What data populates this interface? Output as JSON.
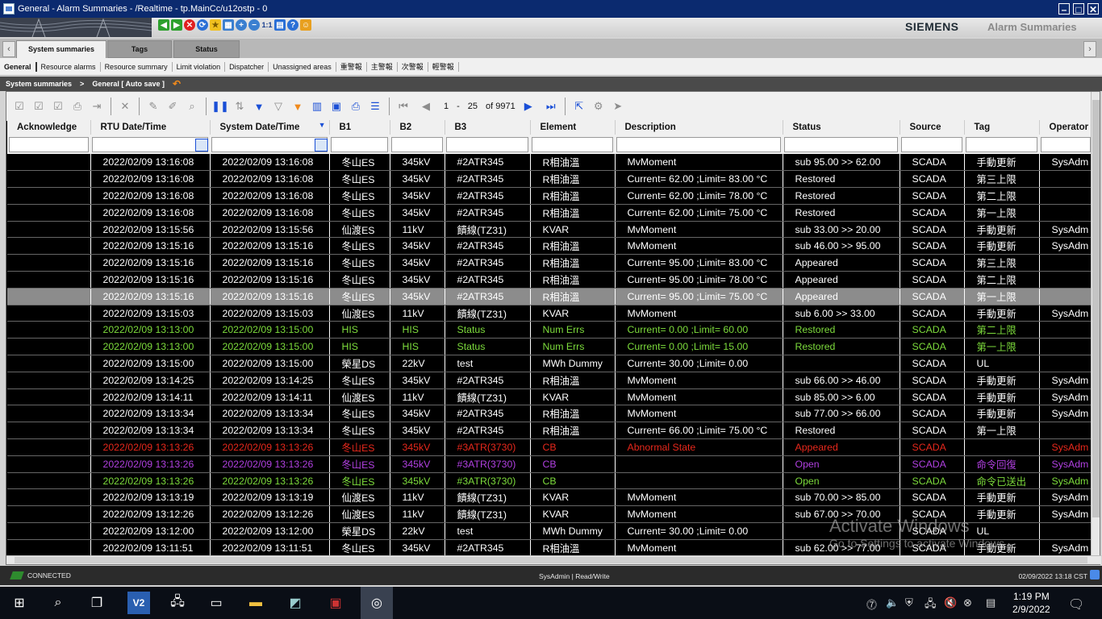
{
  "window": {
    "title": "General - Alarm Summaries - /Realtime - tp.MainCc/u12ostp - 0"
  },
  "banner": {
    "brand": "SIEMENS",
    "app_title": "Alarm Summaries",
    "zoom_label": "1:1"
  },
  "tabs": [
    {
      "label": "System summaries",
      "active": true
    },
    {
      "label": "Tags",
      "active": false
    },
    {
      "label": "Status",
      "active": false
    }
  ],
  "subtabs": [
    "General",
    "Resource alarms",
    "Resource summary",
    "Limit violation",
    "Dispatcher",
    "Unassigned areas",
    "重警報",
    "主警報",
    "次警報",
    "輕警報"
  ],
  "breadcrumb": {
    "root": "System summaries",
    "separator": ">",
    "current": "General  [ Auto save ]"
  },
  "pager": {
    "current": "1",
    "dash": "-",
    "size": "25",
    "of_label": "of 9971"
  },
  "columns": [
    "Acknowledge",
    "RTU Date/Time",
    "System Date/Time",
    "B1",
    "B2",
    "B3",
    "Element",
    "Description",
    "Status",
    "Source",
    "Tag",
    "Operator"
  ],
  "colors": {
    "white": "#ffffff",
    "green": "#7ddc3c",
    "red": "#e8281c",
    "purple": "#b040e0",
    "selected_bg": "#8c8c8c",
    "row_bg": "#000000"
  },
  "rows": [
    {
      "ack": "",
      "rtu": "2022/02/09 13:16:08",
      "sys": "2022/02/09 13:16:08",
      "b1": "冬山ES",
      "b2": "345kV",
      "b3": "#2ATR345",
      "element": "R相油溫",
      "description": "MvMoment",
      "status": "sub 95.00  >> 62.00",
      "source": "SCADA",
      "tag": "手動更新",
      "operator": "SysAdm",
      "color": "white"
    },
    {
      "ack": "",
      "rtu": "2022/02/09 13:16:08",
      "sys": "2022/02/09 13:16:08",
      "b1": "冬山ES",
      "b2": "345kV",
      "b3": "#2ATR345",
      "element": "R相油溫",
      "description": "Current= 62.00 ;Limit= 83.00 °C",
      "status": "Restored",
      "source": "SCADA",
      "tag": "第三上限",
      "operator": "",
      "color": "white"
    },
    {
      "ack": "",
      "rtu": "2022/02/09 13:16:08",
      "sys": "2022/02/09 13:16:08",
      "b1": "冬山ES",
      "b2": "345kV",
      "b3": "#2ATR345",
      "element": "R相油溫",
      "description": "Current= 62.00 ;Limit= 78.00 °C",
      "status": "Restored",
      "source": "SCADA",
      "tag": "第二上限",
      "operator": "",
      "color": "white"
    },
    {
      "ack": "",
      "rtu": "2022/02/09 13:16:08",
      "sys": "2022/02/09 13:16:08",
      "b1": "冬山ES",
      "b2": "345kV",
      "b3": "#2ATR345",
      "element": "R相油溫",
      "description": "Current= 62.00 ;Limit= 75.00 °C",
      "status": "Restored",
      "source": "SCADA",
      "tag": "第一上限",
      "operator": "",
      "color": "white"
    },
    {
      "ack": "",
      "rtu": "2022/02/09 13:15:56",
      "sys": "2022/02/09 13:15:56",
      "b1": "仙渡ES",
      "b2": "11kV",
      "b3": "饋線(TZ31)",
      "element": "KVAR",
      "description": "MvMoment",
      "status": "sub 33.00  >> 20.00",
      "source": "SCADA",
      "tag": "手動更新",
      "operator": "SysAdm",
      "color": "white"
    },
    {
      "ack": "",
      "rtu": "2022/02/09 13:15:16",
      "sys": "2022/02/09 13:15:16",
      "b1": "冬山ES",
      "b2": "345kV",
      "b3": "#2ATR345",
      "element": "R相油溫",
      "description": "MvMoment",
      "status": "sub 46.00  >> 95.00",
      "source": "SCADA",
      "tag": "手動更新",
      "operator": "SysAdm",
      "color": "white"
    },
    {
      "ack": "",
      "rtu": "2022/02/09 13:15:16",
      "sys": "2022/02/09 13:15:16",
      "b1": "冬山ES",
      "b2": "345kV",
      "b3": "#2ATR345",
      "element": "R相油溫",
      "description": "Current= 95.00 ;Limit= 83.00 °C",
      "status": "Appeared",
      "source": "SCADA",
      "tag": "第三上限",
      "operator": "",
      "color": "white"
    },
    {
      "ack": "",
      "rtu": "2022/02/09 13:15:16",
      "sys": "2022/02/09 13:15:16",
      "b1": "冬山ES",
      "b2": "345kV",
      "b3": "#2ATR345",
      "element": "R相油溫",
      "description": "Current= 95.00 ;Limit= 78.00 °C",
      "status": "Appeared",
      "source": "SCADA",
      "tag": "第二上限",
      "operator": "",
      "color": "white"
    },
    {
      "ack": "",
      "rtu": "2022/02/09 13:15:16",
      "sys": "2022/02/09 13:15:16",
      "b1": "冬山ES",
      "b2": "345kV",
      "b3": "#2ATR345",
      "element": "R相油溫",
      "description": "Current= 95.00 ;Limit= 75.00 °C",
      "status": "Appeared",
      "source": "SCADA",
      "tag": "第一上限",
      "operator": "",
      "color": "white",
      "selected": true
    },
    {
      "ack": "",
      "rtu": "2022/02/09 13:15:03",
      "sys": "2022/02/09 13:15:03",
      "b1": "仙渡ES",
      "b2": "11kV",
      "b3": "饋線(TZ31)",
      "element": "KVAR",
      "description": "MvMoment",
      "status": "sub 6.00  >> 33.00",
      "source": "SCADA",
      "tag": "手動更新",
      "operator": "SysAdm",
      "color": "white"
    },
    {
      "ack": "",
      "rtu": "2022/02/09 13:13:00",
      "sys": "2022/02/09 13:15:00",
      "b1": "HIS",
      "b2": "HIS",
      "b3": "Status",
      "element": "Num Errs",
      "description": "Current= 0.00 ;Limit= 60.00",
      "status": "Restored",
      "source": "SCADA",
      "tag": "第二上限",
      "operator": "",
      "color": "green"
    },
    {
      "ack": "",
      "rtu": "2022/02/09 13:13:00",
      "sys": "2022/02/09 13:15:00",
      "b1": "HIS",
      "b2": "HIS",
      "b3": "Status",
      "element": "Num Errs",
      "description": "Current= 0.00 ;Limit= 15.00",
      "status": "Restored",
      "source": "SCADA",
      "tag": "第一上限",
      "operator": "",
      "color": "green"
    },
    {
      "ack": "",
      "rtu": "2022/02/09 13:15:00",
      "sys": "2022/02/09 13:15:00",
      "b1": "榮星DS",
      "b2": "22kV",
      "b3": "test",
      "element": "MWh Dummy",
      "description": "Current= 30.00 ;Limit= 0.00",
      "status": "",
      "source": "SCADA",
      "tag": "UL",
      "operator": "",
      "color": "white"
    },
    {
      "ack": "",
      "rtu": "2022/02/09 13:14:25",
      "sys": "2022/02/09 13:14:25",
      "b1": "冬山ES",
      "b2": "345kV",
      "b3": "#2ATR345",
      "element": "R相油溫",
      "description": "MvMoment",
      "status": "sub 66.00  >> 46.00",
      "source": "SCADA",
      "tag": "手動更新",
      "operator": "SysAdm",
      "color": "white"
    },
    {
      "ack": "",
      "rtu": "2022/02/09 13:14:11",
      "sys": "2022/02/09 13:14:11",
      "b1": "仙渡ES",
      "b2": "11kV",
      "b3": "饋線(TZ31)",
      "element": "KVAR",
      "description": "MvMoment",
      "status": "sub 85.00  >> 6.00",
      "source": "SCADA",
      "tag": "手動更新",
      "operator": "SysAdm",
      "color": "white"
    },
    {
      "ack": "",
      "rtu": "2022/02/09 13:13:34",
      "sys": "2022/02/09 13:13:34",
      "b1": "冬山ES",
      "b2": "345kV",
      "b3": "#2ATR345",
      "element": "R相油溫",
      "description": "MvMoment",
      "status": "sub 77.00  >> 66.00",
      "source": "SCADA",
      "tag": "手動更新",
      "operator": "SysAdm",
      "color": "white"
    },
    {
      "ack": "",
      "rtu": "2022/02/09 13:13:34",
      "sys": "2022/02/09 13:13:34",
      "b1": "冬山ES",
      "b2": "345kV",
      "b3": "#2ATR345",
      "element": "R相油溫",
      "description": "Current= 66.00 ;Limit= 75.00 °C",
      "status": "Restored",
      "source": "SCADA",
      "tag": "第一上限",
      "operator": "",
      "color": "white"
    },
    {
      "ack": "",
      "rtu": "2022/02/09 13:13:26",
      "sys": "2022/02/09 13:13:26",
      "b1": "冬山ES",
      "b2": "345kV",
      "b3": "#3ATR(3730)",
      "element": "CB",
      "description": "Abnormal State",
      "status": "Appeared",
      "source": "SCADA",
      "tag": "",
      "operator": "SysAdm",
      "color": "red"
    },
    {
      "ack": "",
      "rtu": "2022/02/09 13:13:26",
      "sys": "2022/02/09 13:13:26",
      "b1": "冬山ES",
      "b2": "345kV",
      "b3": "#3ATR(3730)",
      "element": "CB",
      "description": "",
      "status": "Open",
      "source": "SCADA",
      "tag": "命令回復",
      "operator": "SysAdm",
      "color": "purple"
    },
    {
      "ack": "",
      "rtu": "2022/02/09 13:13:26",
      "sys": "2022/02/09 13:13:26",
      "b1": "冬山ES",
      "b2": "345kV",
      "b3": "#3ATR(3730)",
      "element": "CB",
      "description": "",
      "status": "Open",
      "source": "SCADA",
      "tag": "命令已送出",
      "operator": "SysAdm",
      "color": "green"
    },
    {
      "ack": "",
      "rtu": "2022/02/09 13:13:19",
      "sys": "2022/02/09 13:13:19",
      "b1": "仙渡ES",
      "b2": "11kV",
      "b3": "饋線(TZ31)",
      "element": "KVAR",
      "description": "MvMoment",
      "status": "sub 70.00  >> 85.00",
      "source": "SCADA",
      "tag": "手動更新",
      "operator": "SysAdm",
      "color": "white"
    },
    {
      "ack": "",
      "rtu": "2022/02/09 13:12:26",
      "sys": "2022/02/09 13:12:26",
      "b1": "仙渡ES",
      "b2": "11kV",
      "b3": "饋線(TZ31)",
      "element": "KVAR",
      "description": "MvMoment",
      "status": "sub 67.00  >> 70.00",
      "source": "SCADA",
      "tag": "手動更新",
      "operator": "SysAdm",
      "color": "white"
    },
    {
      "ack": "",
      "rtu": "2022/02/09 13:12:00",
      "sys": "2022/02/09 13:12:00",
      "b1": "榮星DS",
      "b2": "22kV",
      "b3": "test",
      "element": "MWh Dummy",
      "description": "Current= 30.00 ;Limit= 0.00",
      "status": "",
      "source": "SCADA",
      "tag": "UL",
      "operator": "",
      "color": "white"
    },
    {
      "ack": "",
      "rtu": "2022/02/09 13:11:51",
      "sys": "2022/02/09 13:11:51",
      "b1": "冬山ES",
      "b2": "345kV",
      "b3": "#2ATR345",
      "element": "R相油溫",
      "description": "MvMoment",
      "status": "sub 62.00  >> 77.00",
      "source": "SCADA",
      "tag": "手動更新",
      "operator": "SysAdm",
      "color": "white"
    }
  ],
  "watermark": {
    "title": "Activate Windows",
    "subtitle": "Go to Settings to activate Windows."
  },
  "statusbar": {
    "connection": "CONNECTED",
    "user": "SysAdmin  |  Read/Write",
    "timestamp": "02/09/2022 13:18 CST"
  },
  "taskbar": {
    "time": "1:19 PM",
    "date": "2/9/2022",
    "vs_label": "V2"
  }
}
